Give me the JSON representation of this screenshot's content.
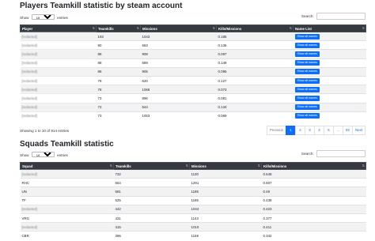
{
  "players": {
    "title": "Players Teamkill statistic by steam account",
    "show_label_pre": "Show",
    "show_value": "10",
    "show_label_post": "entries",
    "search_label": "Search:",
    "search_value": "",
    "columns": [
      "Player",
      "Teamkills",
      "Missions",
      "Kills/Missions",
      "Name List"
    ],
    "rows": [
      {
        "player": "[redacted]",
        "teamkills": "193",
        "missions": "1043",
        "ratio": "0.185",
        "button": "Show all names"
      },
      {
        "player": "[redacted]",
        "teamkills": "90",
        "missions": "663",
        "ratio": "0.136",
        "button": "Show all names"
      },
      {
        "player": "[redacted]",
        "teamkills": "88",
        "missions": "908",
        "ratio": "0.097",
        "button": "Show all names"
      },
      {
        "player": "[redacted]",
        "teamkills": "88",
        "missions": "589",
        "ratio": "0.149",
        "button": "Show all names"
      },
      {
        "player": "[redacted]",
        "teamkills": "86",
        "missions": "905",
        "ratio": "0.095",
        "button": "Show all names"
      },
      {
        "player": "[redacted]",
        "teamkills": "79",
        "missions": "620",
        "ratio": "0.127",
        "button": "Show all names"
      },
      {
        "player": "[redacted]",
        "teamkills": "78",
        "missions": "1068",
        "ratio": "0.073",
        "button": "Show all names"
      },
      {
        "player": "[redacted]",
        "teamkills": "73",
        "missions": "896",
        "ratio": "0.081",
        "button": "Show all names"
      },
      {
        "player": "[redacted]",
        "teamkills": "73",
        "missions": "544",
        "ratio": "0.134",
        "button": "Show all names"
      },
      {
        "player": "[redacted]",
        "teamkills": "73",
        "missions": "1053",
        "ratio": "0.069",
        "button": "Show all names"
      }
    ],
    "info": "Showing 1 to 10 of 914 entries",
    "pagination": {
      "previous": "Previous",
      "pages": [
        "1",
        "2",
        "3",
        "4",
        "5",
        "…",
        "92"
      ],
      "active": "1",
      "next": "Next"
    }
  },
  "squads": {
    "title": "Squads Teamkill statistic",
    "show_label_pre": "Show",
    "show_value": "10",
    "show_label_post": "entries",
    "search_label": "Search:",
    "search_value": "",
    "columns": [
      "Squad",
      "Teamkills",
      "Missions",
      "Kills/Missions"
    ],
    "rows": [
      {
        "squad": "[redacted]",
        "teamkills": "732",
        "missions": "1130",
        "ratio": "0.648"
      },
      {
        "squad": "RHC",
        "teamkills": "654",
        "missions": "1291",
        "ratio": "0.507"
      },
      {
        "squad": "UN",
        "teamkills": "581",
        "missions": "1185",
        "ratio": "0.49"
      },
      {
        "squad": "TF",
        "teamkills": "525",
        "missions": "1195",
        "ratio": "0.439"
      },
      {
        "squad": "[redacted]",
        "teamkills": "442",
        "missions": "1044",
        "ratio": "0.423"
      },
      {
        "squad": "VRG",
        "teamkills": "431",
        "missions": "1143",
        "ratio": "0.377"
      },
      {
        "squad": "[redacted]",
        "teamkills": "415",
        "missions": "1010",
        "ratio": "0.411"
      },
      {
        "squad": "CBR",
        "teamkills": "396",
        "missions": "1159",
        "ratio": "0.342"
      }
    ]
  },
  "colors": {
    "header_bg": "#343a40",
    "button_blue": "#0d6efd",
    "stripe": "#f2f2f2"
  },
  "icons": {
    "sort": "sort-arrows-icon"
  }
}
